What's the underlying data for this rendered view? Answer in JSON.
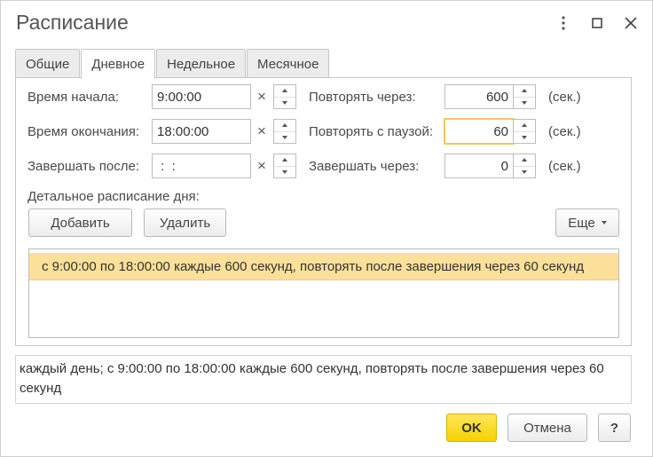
{
  "window": {
    "title": "Расписание",
    "icons": {
      "more": "vertical-dots-icon",
      "maximize": "maximize-icon",
      "close": "close-icon"
    }
  },
  "tabs": [
    {
      "label": "Общие",
      "active": false
    },
    {
      "label": "Дневное",
      "active": true
    },
    {
      "label": "Недельное",
      "active": false
    },
    {
      "label": "Месячное",
      "active": false
    }
  ],
  "daily": {
    "start_label": "Время начала:",
    "start_value": "9:00:00",
    "end_label": "Время окончания:",
    "end_value": "18:00:00",
    "finish_after_label": "Завершать после:",
    "finish_after_value": " :  :",
    "repeat_every_label": "Повторять через:",
    "repeat_every_value": "600",
    "repeat_pause_label": "Повторять с паузой:",
    "repeat_pause_value": "60",
    "finish_in_label": "Завершать через:",
    "finish_in_value": "0",
    "unit": "(сек.)",
    "clear_glyph": "×",
    "detail_label": "Детальное расписание дня:",
    "add_button": "Добавить",
    "delete_button": "Удалить",
    "more_button": "Еще",
    "list_rows": [
      "с 9:00:00 по 18:00:00 каждые 600 секунд, повторять после завершения через 60 секунд"
    ]
  },
  "summary_text": "каждый день; с 9:00:00 по 18:00:00 каждые 600 секунд, повторять после завершения через 60 секунд",
  "footer": {
    "ok_button": "OK",
    "cancel_button": "Отмена",
    "help_button": "?"
  },
  "colors": {
    "accent_yellow": "#f5d200",
    "selected_row": "#fbe09a",
    "focus_border": "#f1c95b"
  }
}
